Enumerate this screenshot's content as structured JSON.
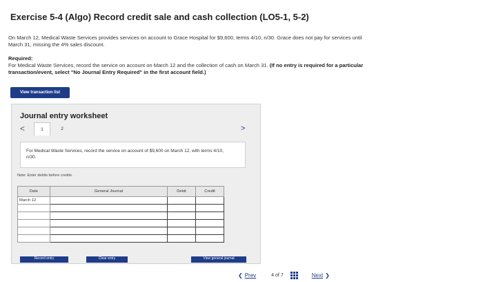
{
  "header": {
    "title": "Exercise 5-4 (Algo) Record credit sale and cash collection (LO5-1, 5-2)"
  },
  "problem": {
    "intro": "On March 12, Medical Waste Services provides services on account to Grace Hospital for $9,600, terms 4/10, n/30. Grace does not pay for services until March 31, missing the 4% sales discount.",
    "required_label": "Required:",
    "required_text": "For Medical Waste Services, record the service on account on March 12 and the collection of cash on March 31.",
    "required_bold": "(If no entry is required for a particular transaction/event, select \"No Journal Entry Required\" in the first account field.)"
  },
  "view_button": "View transaction list",
  "worksheet": {
    "title": "Journal entry worksheet",
    "tabs": [
      "1",
      "2"
    ],
    "prev_glyph": "<",
    "next_glyph": ">",
    "description": "For Medical Waste Services, record the service on account of $9,600 on March 12, with terms 4/10, n/30.",
    "note": "Note: Enter debits before credits.",
    "table": {
      "headers": [
        "Date",
        "General Journal",
        "Debit",
        "Credit"
      ],
      "rows": [
        [
          "March 12",
          "",
          "",
          ""
        ],
        [
          "",
          "",
          "",
          ""
        ],
        [
          "",
          "",
          "",
          ""
        ],
        [
          "",
          "",
          "",
          ""
        ],
        [
          "",
          "",
          "",
          ""
        ],
        [
          "",
          "",
          "",
          ""
        ]
      ]
    },
    "buttons": [
      "Record entry",
      "Clear entry",
      "View general journal"
    ]
  },
  "pager": {
    "prev": "Prev",
    "current": "4",
    "of": "of",
    "total": "7",
    "next": "Next"
  }
}
